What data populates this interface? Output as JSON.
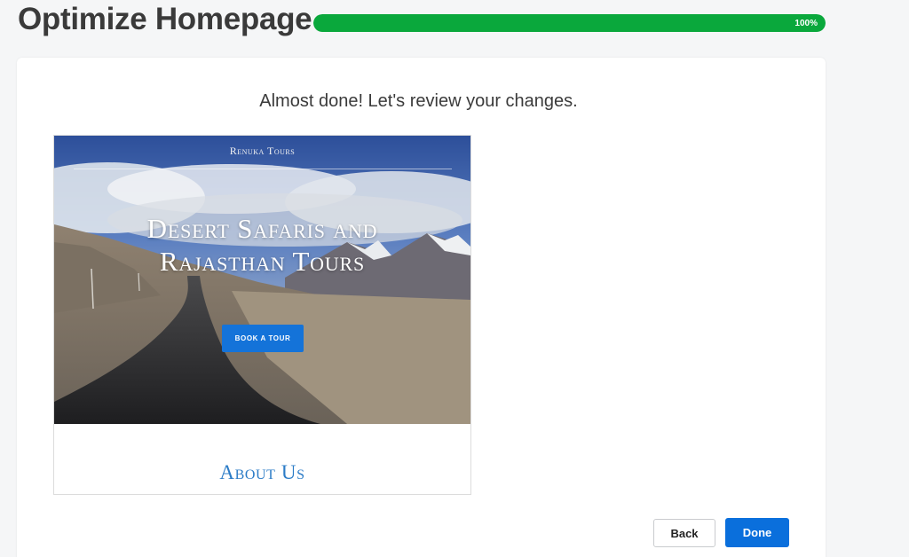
{
  "header": {
    "title": "Optimize Homepage",
    "progress": {
      "percent": 100,
      "label": "100%",
      "color": "#0aa83c"
    }
  },
  "main": {
    "subtitle": "Almost done! Let's review your changes.",
    "preview": {
      "site_name": "Renuka Tours",
      "headline": "Desert Safaris and Rajasthan Tours",
      "cta_label": "BOOK A TOUR",
      "section_heading": "About Us",
      "hero_image": "mountain-road-landscape"
    }
  },
  "footer": {
    "back_label": "Back",
    "done_label": "Done",
    "accent_color": "#0a6fdc"
  }
}
